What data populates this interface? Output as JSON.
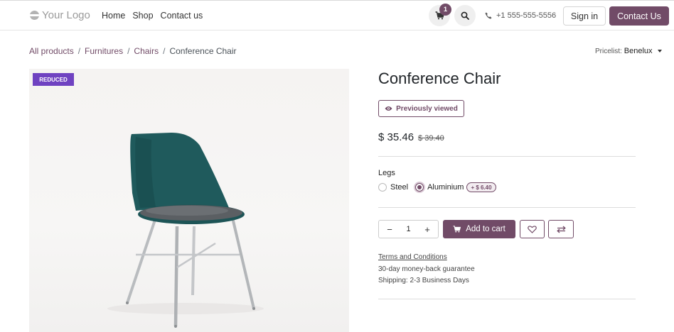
{
  "header": {
    "logo_text": "Your Logo",
    "nav": [
      "Home",
      "Shop",
      "Contact us"
    ],
    "cart_count": "1",
    "phone": "+1 555-555-5556",
    "signin_label": "Sign in",
    "contact_label": "Contact Us",
    "accent_color": "#714b67"
  },
  "breadcrumb": {
    "items": [
      "All products",
      "Furnitures",
      "Chairs"
    ],
    "active": "Conference Chair",
    "separator": "/"
  },
  "pricelist": {
    "label": "Pricelist:",
    "value": "Benelux"
  },
  "product": {
    "ribbon": "REDUCED",
    "title": "Conference Chair",
    "badge": "Previously viewed",
    "price": "$ 35.46",
    "old_price": "$ 39.40",
    "attribute_label": "Legs",
    "options": [
      {
        "label": "Steel",
        "selected": false
      },
      {
        "label": "Aluminium",
        "selected": true,
        "extra": "+ $ 6.40"
      }
    ],
    "quantity": "1",
    "add_to_cart_label": "Add to cart",
    "terms": "Terms and Conditions",
    "guarantee": "30-day money-back guarantee",
    "shipping": "Shipping: 2-3 Business Days"
  }
}
